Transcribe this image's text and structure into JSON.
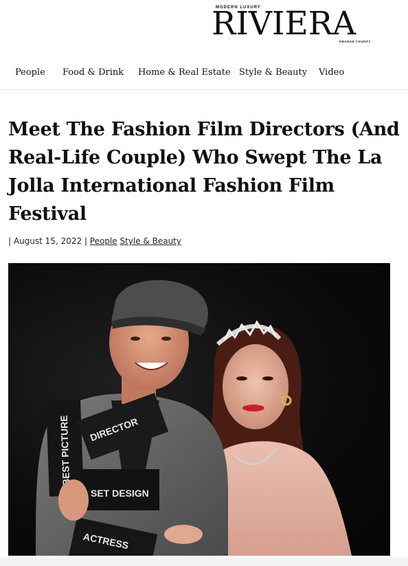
{
  "brand": {
    "top_line": "MODERN LUXURY",
    "name": "RIVIERA",
    "region": "ORANGE COUNTY"
  },
  "nav": {
    "items": [
      {
        "label": "People"
      },
      {
        "label": "Food & Drink"
      },
      {
        "label": "Home & Real Estate"
      },
      {
        "label": "Style & Beauty"
      },
      {
        "label": "Video"
      }
    ]
  },
  "article": {
    "title": "Meet The Fashion Film Directors (And Real-Life Couple) Who Swept The La Jolla International Fashion Film Festival",
    "date": "August 15, 2022",
    "categories": [
      "People",
      "Style & Beauty"
    ]
  },
  "photo": {
    "cards": [
      {
        "label": "BEST PICTURE"
      },
      {
        "label": "DIRECTOR"
      },
      {
        "label": "SET DESIGN"
      },
      {
        "label": "ACTRESS"
      }
    ]
  }
}
